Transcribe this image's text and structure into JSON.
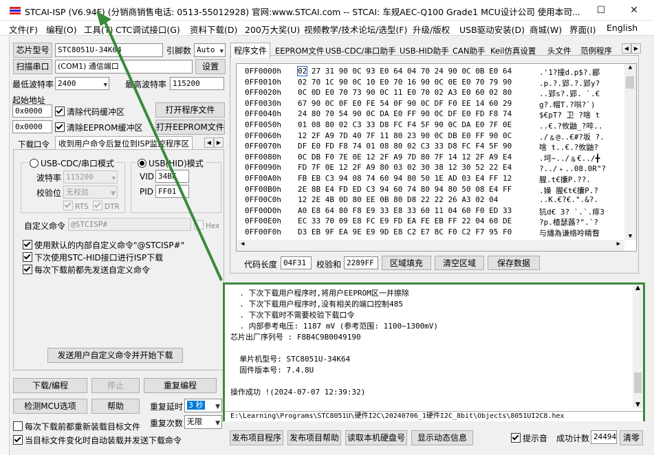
{
  "window": {
    "title": "STCAI-ISP (V6.94F) (分销商销售电话: 0513-55012928) 官网:www.STCAI.com  -- STCAI: 车规AEC-Q100 Grade1 MCU设计公司 使用本司...",
    "minimize": "—",
    "maximize": "☐",
    "close": "✕"
  },
  "menu": [
    "文件(F)",
    "编程(O)",
    "工具(T)",
    "CTC调试接口(G)",
    "资料下载(D)",
    "200万大奖(U)",
    "视频教学/技术论坛/选型(F)",
    "升级/版权",
    "USB驱动安装(D)",
    "商城(W)",
    "界面(I)",
    "English"
  ],
  "left": {
    "chip_type_btn": "芯片型号",
    "chip_type_value": "STC8051U-34K64",
    "pin_label": "引脚数",
    "pin_value": "Auto",
    "scan_btn": "扫描串口",
    "port_value": "(COM1) 通信端口",
    "settings_btn": "设置",
    "min_baud_label": "最低波特率",
    "min_baud_value": "2400",
    "max_baud_label": "最高波特率",
    "max_baud_value": "115200",
    "start_addr_label": "起始地址",
    "code_addr": "0x0000",
    "clear_code_label": "清除代码缓冲区",
    "open_prog_btn": "打开程序文件",
    "eeprom_addr": "0x0000",
    "clear_eeprom_label": "清除EEPROM缓冲区",
    "open_eeprom_btn": "打开EEPROM文件",
    "subtab_download": "下载口令",
    "subtab_monitor": "收到用户命令后复位到ISP监控程序区",
    "usb_cdc_label": "USB-CDC/串口模式",
    "usb_hid_label": "USB(HID)模式",
    "baud_label": "波特率",
    "baud_value": "115200",
    "parity_label": "校验位",
    "parity_value": "无校验",
    "rts_label": "RTS",
    "dtr_label": "DTR",
    "vid_label": "VID",
    "vid_value": "34BF",
    "pid_label": "PID",
    "pid_value": "FF01",
    "custom_cmd_label": "自定义命令",
    "custom_cmd_value": "@STCISP#",
    "hex_label": "Hex",
    "opt1": "使用默认的内部自定义命令\"@STCISP#\"",
    "opt2": "下次使用STC-HID接口进行ISP下载",
    "opt3": "每次下载前都先发送自定义命令",
    "send_btn": "发送用户自定义命令并开始下载",
    "download_btn": "下载/编程",
    "stop_btn": "停止",
    "reprogram_btn": "重复编程",
    "check_mcu_btn": "检测MCU选项",
    "help_btn": "帮助",
    "repeat_delay_label": "重复延时",
    "repeat_delay_value": "3 秒",
    "repeat_count_label": "重复次数",
    "repeat_count_value": "无限",
    "reload_label": "每次下载前都重新装载目标文件",
    "auto_label": "当目标文件变化时自动装载并发送下载命令"
  },
  "right": {
    "tabs": [
      "程序文件",
      "EEPROM文件",
      "USB-CDC/串口助手",
      "USB-HID助手",
      "CAN助手",
      "Keil仿真设置",
      "头文件",
      "范例程序"
    ],
    "hex_rows": [
      {
        "addr": "0FF0000h",
        "bytes": "02 27 31 90 0C 93 E0 64 04 70 24 90 0C 0B E0 64",
        "ascii": ".'1?撞d.p$?.郿"
      },
      {
        "addr": "0FF0010h",
        "bytes": "02 70 1C 90 0C 10 E0 70 16 90 0C 0E E0 70 79 90",
        "ascii": ".p.?.郢.?.郢y?"
      },
      {
        "addr": "0FF0020h",
        "bytes": "0C 0D E0 70 73 90 0C 11 E0 70 02 A3 E0 60 02 80",
        "ascii": "..郢s?.郢. `.€"
      },
      {
        "addr": "0FF0030h",
        "bytes": "67 90 0C 0F E0 FE 54 0F 90 0C DF F0 EE 14 60 29",
        "ascii": "g?.帽T.?唞?`)"
      },
      {
        "addr": "0FF0040h",
        "bytes": "24 80 70 54 90 0C DA E0 FF 90 0C DF E0 FD F8 74",
        "ascii": "$€pT? 卫 ?啥  t"
      },
      {
        "addr": "0FF0050h",
        "bytes": "01 08 80 02 C3 33 D8 FC F4 5F 90 0C DA E0 7F 0E",
        "ascii": "..€.?攸鼬_?啐.."
      },
      {
        "addr": "0FF0060h",
        "bytes": "12 2F A9 7D 40 7F 11 80 23 90 0C DB E0 FF 90 0C",
        "ascii": "./﹠@..€#?坂 ?."
      },
      {
        "addr": "0FF0070h",
        "bytes": "DF E0 FD F8 74 01 08 80 02 C3 33 D8 FC F4 5F 90",
        "ascii": "啥  t..€.?攸鼬?"
      },
      {
        "addr": "0FF0080h",
        "bytes": "0C DB F0 7E 0E 12 2F A9 7D 80 7F 14 12 2F A9 E4",
        "ascii": ".坷~../﹠€../╋"
      },
      {
        "addr": "0FF0090h",
        "bytes": "FD 7F 0E 12 2F A9 80 03 02 30 38 12 30 52 22 E4",
        "ascii": "?../﹢..08.0R\"?"
      },
      {
        "addr": "0FF00A0h",
        "bytes": "FB EB C3 94 08 74 60 94 80 50 1E AD 03 E4 FF 12",
        "ascii": "  腥.t€攮P.??."
      },
      {
        "addr": "0FF00B0h",
        "bytes": "2E 8B E4 FD ED C3 94 60 74 80 94 80 50 08 E4 FF",
        "ascii": ".嬠  腥€t€攮P.?"
      },
      {
        "addr": "0FF00C0h",
        "bytes": "12 2E 4B 0D 80 EE 0B 80 D8 22 22 26 A3 02 04",
        "ascii": "..K.€?€.\".&?."
      },
      {
        "addr": "0FF00D0h",
        "bytes": "A0 E8 64 80 F8 E9 33 E8 33 60 11 04 60 F0 ED 33",
        "ascii": "犺d€  3? `.`.痱3"
      },
      {
        "addr": "0FF00E0h",
        "bytes": "EC 33 70 09 E8 FC E9 FD EA FE EB FF 22 04 60 DE",
        "ascii": "?p.楂瑟蕗?\".`?"
      },
      {
        "addr": "0FF00F0h",
        "bytes": "D3 EB 9F EA 9E E9 9D E8 C2 E7 8C F0 C2 F7 95 F0",
        "ascii": "与熽為谦络呤睛瞀"
      }
    ],
    "code_len_label": "代码长度",
    "code_len_value": "04F31",
    "checksum_label": "校验和",
    "checksum_value": "2289FF",
    "fill_btn": "区域填充",
    "clear_btn": "清空区域",
    "save_btn": "保存数据",
    "log_lines": [
      "  . 下次下载用户程序时,将用户EEPROM区一并擦除",
      "  . 下次下载用户程序时,没有相关的端口控制485",
      "  . 下次下载时不需要校验下载口令",
      "  . 内部参考电压: 1187 mV (参考范围: 1100~1300mV)",
      "芯片出厂序列号 : F8B4C9B0049190",
      "",
      "  单片机型号: STC8051U-34K64",
      "  固件版本号: 7.4.8U",
      "",
      "操作成功 !(2024-07-07 12:39:32)"
    ],
    "file_path": "E:\\Learning\\Programs\\STC8051U\\硬件I2C\\20240706_1硬件I2C_8bit\\Objects\\8051UI2C8.hex",
    "publish_prog_btn": "发布项目程序",
    "publish_help_btn": "发布项目帮助",
    "read_disk_btn": "读取本机硬盘号",
    "show_dyn_btn": "显示动态信息",
    "beep_label": "提示音",
    "success_label": "成功计数",
    "success_value": "24494",
    "clear_count_btn": "清零"
  },
  "colors": {
    "accent_green": "#3c8a3c",
    "hex_highlight": "#1e64c8"
  }
}
